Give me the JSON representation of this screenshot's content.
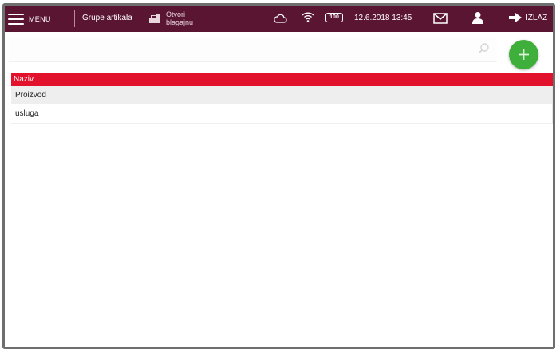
{
  "header": {
    "menu_label": "MENU",
    "page_title": "Grupe artikala",
    "register_line1": "Otvori",
    "register_line2": "blagajnu",
    "battery_level": "100",
    "datetime": "12.6.2018 13:45",
    "exit_label": "IZLAZ"
  },
  "search": {
    "value": "",
    "placeholder": ""
  },
  "table": {
    "columns": [
      "Naziv"
    ],
    "rows": [
      "Proizvod",
      "usluga"
    ]
  },
  "colors": {
    "topbar": "#5a1532",
    "table_header": "#e3122c",
    "add_button": "#3faf3c"
  },
  "icons": [
    "hamburger-icon",
    "cash-register-icon",
    "cloud-icon",
    "wifi-icon",
    "battery-icon",
    "mail-icon",
    "user-icon",
    "exit-arrow-icon",
    "search-icon",
    "plus-icon"
  ]
}
